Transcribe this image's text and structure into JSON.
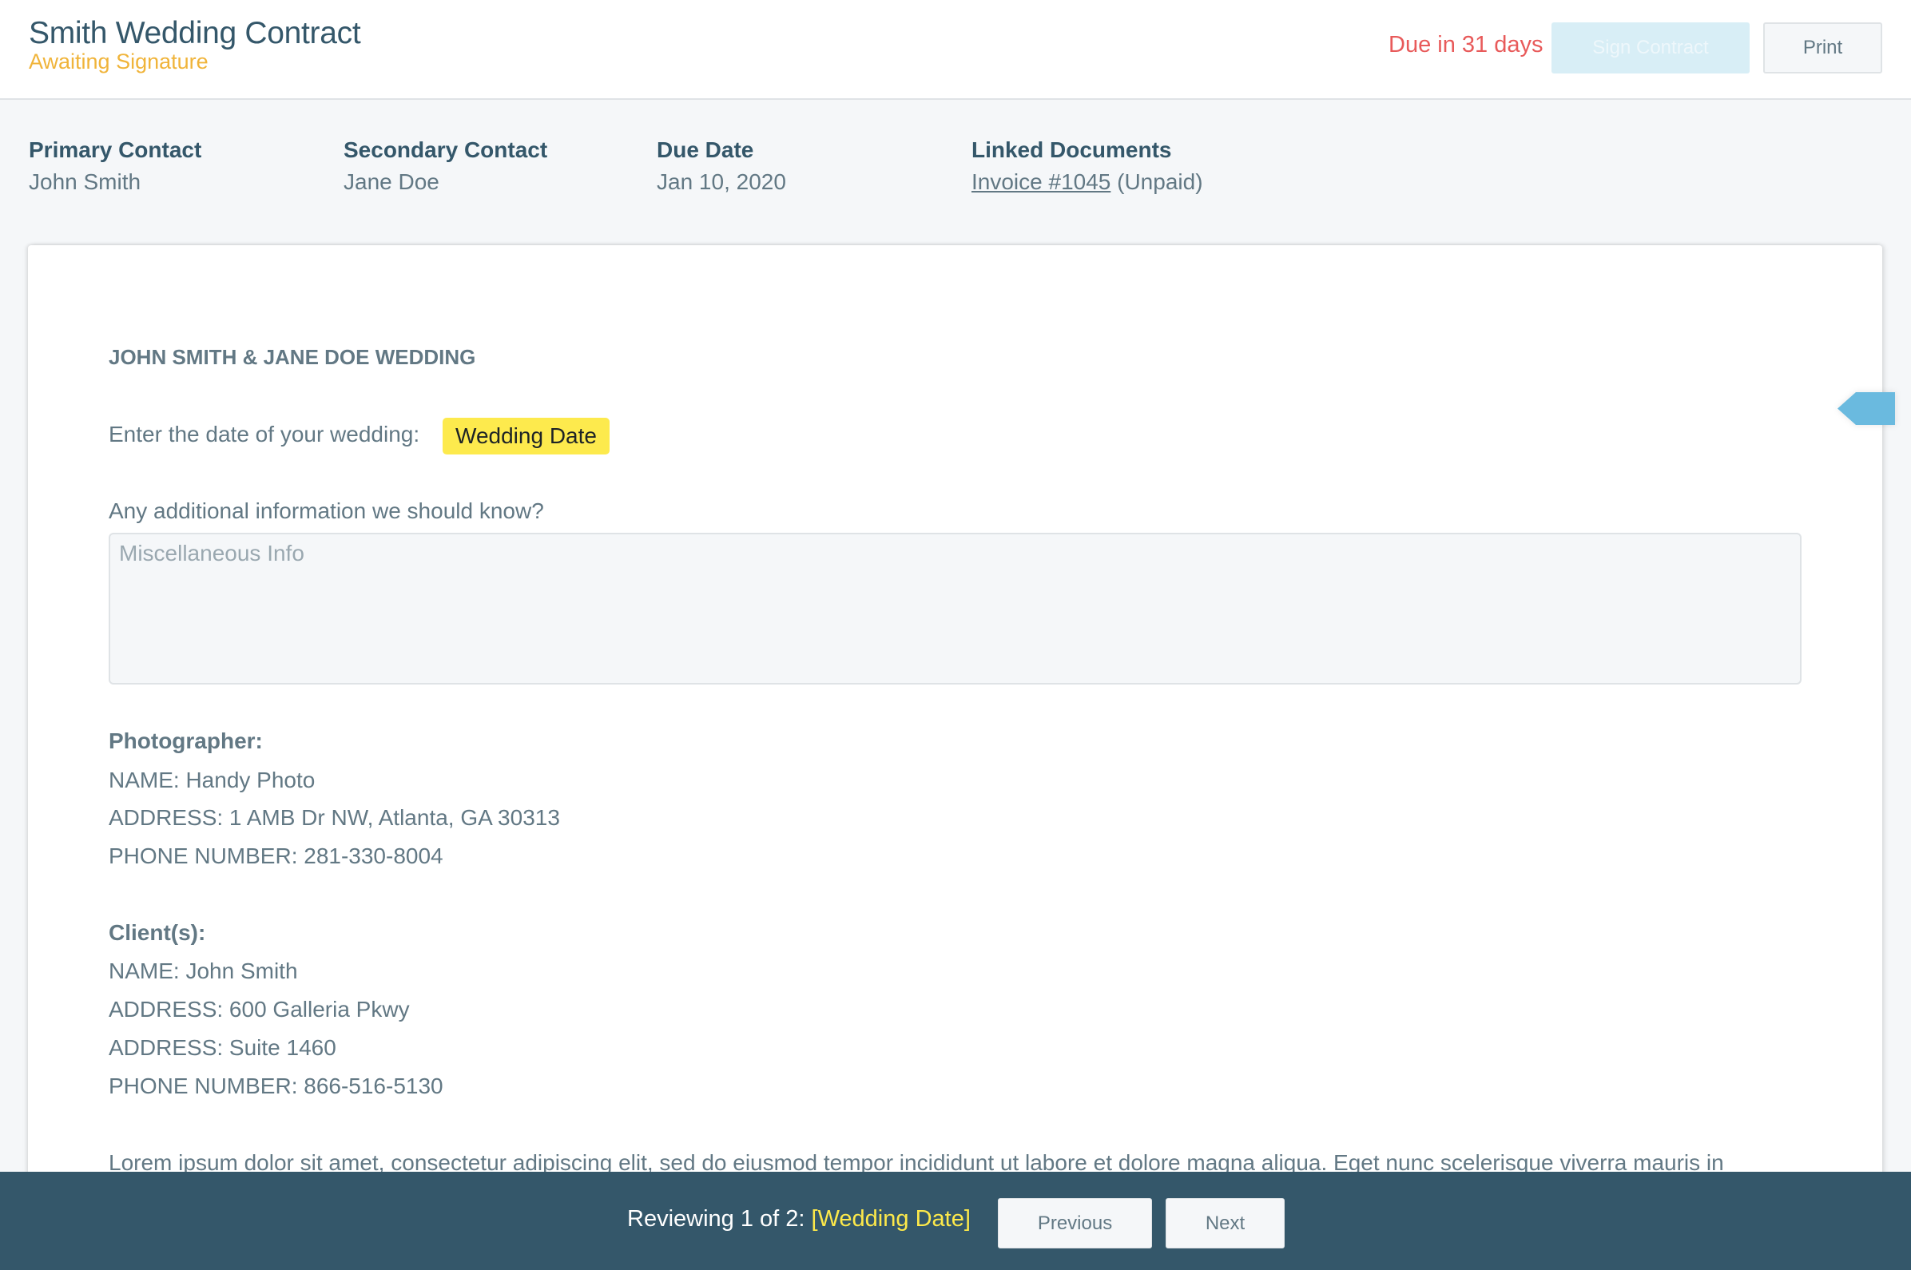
{
  "header": {
    "title": "Smith Wedding Contract",
    "status": "Awaiting Signature",
    "due_text": "Due in 31 days",
    "sign_button": "Sign Contract",
    "print_button": "Print"
  },
  "info": {
    "primary_contact_label": "Primary Contact",
    "primary_contact_value": "John Smith",
    "secondary_contact_label": "Secondary Contact",
    "secondary_contact_value": "Jane Doe",
    "due_date_label": "Due Date",
    "due_date_value": "Jan 10, 2020",
    "linked_documents_label": "Linked Documents",
    "linked_document_link": "Invoice #1045",
    "linked_document_status": " (Unpaid)"
  },
  "document": {
    "heading": "JOHN SMITH & JANE DOE WEDDING",
    "wedding_date_prompt": "Enter the date of your wedding:",
    "wedding_date_field": "Wedding Date",
    "additional_info_prompt": "Any additional information we should know?",
    "misc_placeholder": "Miscellaneous Info",
    "misc_value": "",
    "photographer": {
      "label": "Photographer:",
      "lines": [
        "NAME: Handy Photo",
        "ADDRESS: 1 AMB Dr NW, Atlanta, GA 30313",
        "PHONE NUMBER: 281-330-8004"
      ]
    },
    "clients": {
      "label": "Client(s):",
      "lines": [
        "NAME: John Smith",
        "ADDRESS: 600 Galleria Pkwy",
        "ADDRESS: Suite 1460",
        "PHONE NUMBER: 866-516-5130"
      ]
    },
    "lorem": "Lorem ipsum dolor sit amet, consectetur adipiscing elit, sed do eiusmod tempor incididunt ut labore et dolore magna aliqua. Eget nunc scelerisque viverra mauris in"
  },
  "footer": {
    "reviewing_text": "Reviewing 1 of 2: ",
    "current_field": "[Wedding Date]",
    "previous_button": "Previous",
    "next_button": "Next"
  },
  "colors": {
    "primary": "#34576a",
    "status_awaiting": "#f0b43a",
    "due_warning": "#e85a5a",
    "field_highlight": "#fdea4d",
    "tag_accent": "#6abadf"
  }
}
